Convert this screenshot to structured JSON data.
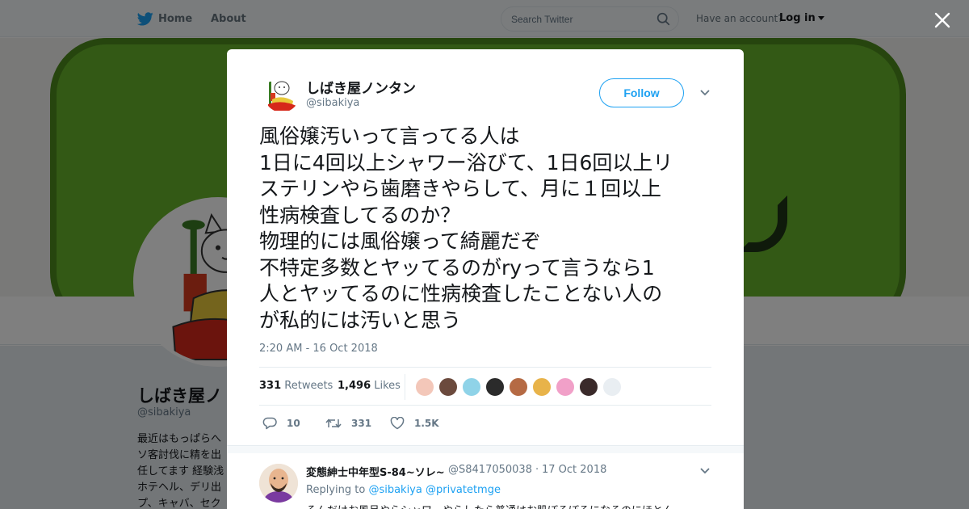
{
  "nav": {
    "home_label": "Home",
    "about_label": "About",
    "search_placeholder": "Search Twitter",
    "account_prompt": "Have an account?",
    "login_label": "Log in"
  },
  "profile": {
    "name": "しばき屋ノ",
    "handle": "@sibakiya",
    "bio_lines": [
      "最近はもっぱらへ",
      "ソ客討伐に精を出",
      "任してます 経験浅",
      "ホテヘル、デリ出",
      "プ、キャバ、セク"
    ]
  },
  "tweet": {
    "author_name": "しばき屋ノンタン",
    "author_handle": "@sibakiya",
    "follow_label": "Follow",
    "text_lines": [
      "風俗嬢汚いって言ってる人は",
      "1日に4回以上シャワー浴びて、1日6回以上リ",
      "ステリンやら歯磨きやらして、月に１回以上",
      "性病検査してるのか？",
      "物理的には風俗嬢って綺麗だぞ",
      "不特定多数とヤッてるのがryって言うなら1",
      "人とヤッてるのに性病検査したことない人の",
      "が私的には汚いと思う"
    ],
    "timestamp": "2:20 AM - 16 Oct 2018",
    "retweets_count": "331",
    "retweets_label": "Retweets",
    "likes_count": "1,496",
    "likes_label": "Likes",
    "reply_count": "10",
    "retweet_action_count": "331",
    "like_action_count": "1.5K",
    "liker_colors": [
      "#f3c7b9",
      "#6b4a3d",
      "#8fd3e8",
      "#2b2b2b",
      "#b56a44",
      "#e8b34a",
      "#f1a0c8",
      "#3a2a2a",
      "#e9eef2"
    ]
  },
  "reply": {
    "name": "変態紳士中年型S-84~ソレ~",
    "handle": "@S8417050038",
    "separator": "·",
    "date": "17 Oct 2018",
    "replying_label": "Replying to",
    "mention_1": "@sibakiya",
    "mention_2": "@privatetmge",
    "text": "そんだけお風呂やらシャワーやらしたら普通はお肌ぼろぼろになるのにほとん"
  },
  "colors": {
    "twitter_blue": "#1da1f2",
    "banner_green": "#67b32b",
    "overlay": "rgba(0,0,0,0.5)"
  }
}
